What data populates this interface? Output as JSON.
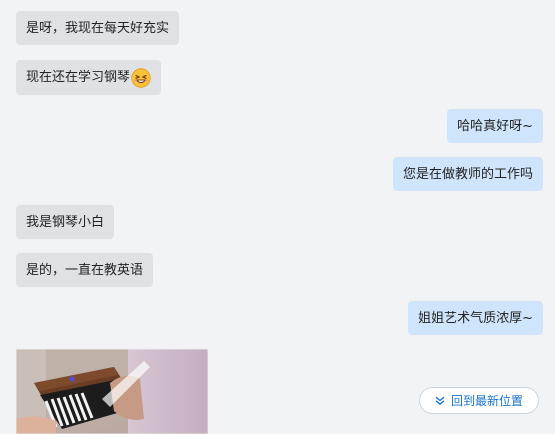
{
  "messages": [
    {
      "text": "是呀，我现在每天好充实"
    },
    {
      "text": "现在还在学习钢琴"
    },
    {
      "text": "哈哈真好呀~"
    },
    {
      "text": "您是在做教师的工作吗"
    },
    {
      "text": "我是钢琴小白"
    },
    {
      "text": "是的，一直在教英语"
    },
    {
      "text": "姐姐艺术气质浓厚~"
    }
  ],
  "emoji": "grinning-squint-emoji",
  "jump_button": {
    "label": "回到最新位置",
    "icon": "double-chevron-down-icon"
  },
  "colors": {
    "background": "#f2f3f5",
    "incoming_bubble": "#dfe1e5",
    "outgoing_bubble": "#cfe5fb",
    "accent": "#1a73c8"
  }
}
